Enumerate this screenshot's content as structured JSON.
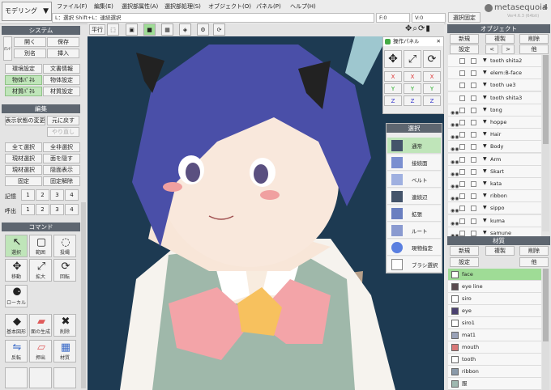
{
  "menu": {
    "mode": "モデリング",
    "items": [
      "ファイル(F)",
      "編集(E)",
      "選択部属性(A)",
      "選択部処理(S)",
      "オブジェクト(O)",
      "パネル(P)",
      "ヘルプ(H)"
    ],
    "status_text": "L：選択  Shift+L：連続選択",
    "f_field": "F:0",
    "v_field": "V:0",
    "select_fix": "選択固定",
    "logo": "metasequoia",
    "logo_num": "4",
    "version": "Ver4.6.3 (64bit)"
  },
  "toolbar": {
    "flat_label": "平行"
  },
  "system": {
    "title": "システム",
    "buttons": [
      "開く",
      "保存",
      "別名",
      "挿入",
      "環境設定",
      "文書情報",
      "物体ﾊﾟﾈﾙ",
      "物体設定",
      "材質ﾊﾟﾈﾙ",
      "材質設定"
    ],
    "side": "ｺﾏﾝﾄﾞ"
  },
  "edit": {
    "title": "編集",
    "buttons": [
      "表示状態の変更",
      "元に戻す",
      "やり直し",
      "全て選択",
      "全非選択",
      "現材選択",
      "面を隠す",
      "現材選択",
      "隠面表示",
      "固定",
      "固定解除"
    ],
    "mem_label": "記憶",
    "recall_label": "呼出",
    "nums": [
      "1",
      "2",
      "3",
      "4"
    ]
  },
  "command": {
    "title": "コマンド",
    "tools": [
      {
        "icon": "arrow-icon",
        "glyph": "↖",
        "label": "選択"
      },
      {
        "icon": "rect-icon",
        "glyph": "▢",
        "label": "範囲"
      },
      {
        "icon": "lasso-icon",
        "glyph": "◌",
        "label": "投縄"
      },
      {
        "icon": "move-icon",
        "glyph": "✥",
        "label": "移動"
      },
      {
        "icon": "scale-icon",
        "glyph": "⤢",
        "label": "拡大"
      },
      {
        "icon": "rotate-icon",
        "glyph": "⟳",
        "label": "回転"
      },
      {
        "icon": "local-icon",
        "glyph": "⚈",
        "label": "ローカル"
      },
      {
        "icon": "primitive-icon",
        "glyph": "◆",
        "label": "基本図形"
      },
      {
        "icon": "face-icon",
        "glyph": "▰",
        "label": "面の生成"
      },
      {
        "icon": "delete-icon",
        "glyph": "✖",
        "label": "削除"
      },
      {
        "icon": "flip-icon",
        "glyph": "⇋",
        "label": "反転"
      },
      {
        "icon": "extrude-icon",
        "glyph": "▱",
        "label": "押出"
      },
      {
        "icon": "material-icon",
        "glyph": "▦",
        "label": "材質"
      }
    ]
  },
  "op_panel": {
    "title": "操作パネル",
    "axes": [
      "X",
      "Y",
      "Z"
    ]
  },
  "sel_panel": {
    "title": "選択",
    "items": [
      "通常",
      "接続面",
      "ベルト",
      "連続辺",
      "拡張",
      "ルート",
      "現物指定",
      "ブラシ選択"
    ]
  },
  "object": {
    "title": "オブジェクト",
    "buttons": [
      "新規",
      "複製",
      "削除",
      "設定",
      "<",
      ">",
      "他"
    ],
    "rows": [
      "tooth shita2",
      "elem:B-face",
      "tooth ue3",
      "tooth shita3",
      "tong",
      "hoppe",
      "Hair",
      "Body",
      "Arm",
      "Skart",
      "kata",
      "ribbon",
      "sippo",
      "kuma",
      "samune"
    ]
  },
  "material": {
    "title": "材質",
    "buttons": [
      "新規",
      "複製",
      "削除",
      "設定",
      "他"
    ],
    "rows": [
      {
        "name": "face",
        "color": "#ffffff"
      },
      {
        "name": "eye line",
        "color": "#5a4a4e"
      },
      {
        "name": "siro",
        "color": "#ffffff"
      },
      {
        "name": "eye",
        "color": "#4a4070"
      },
      {
        "name": "siro1",
        "color": "#ffffff"
      },
      {
        "name": "mat1",
        "color": "#9aa2b8"
      },
      {
        "name": "mouth",
        "color": "#d87878"
      },
      {
        "name": "tooth",
        "color": "#ffffff"
      },
      {
        "name": "ribbon",
        "color": "#8a9aaa"
      },
      {
        "name": "服",
        "color": "#9fb8b0"
      }
    ]
  },
  "colors": {
    "accent": "#9fdc96",
    "viewport": "#1d3a52",
    "header": "#5e6670"
  }
}
